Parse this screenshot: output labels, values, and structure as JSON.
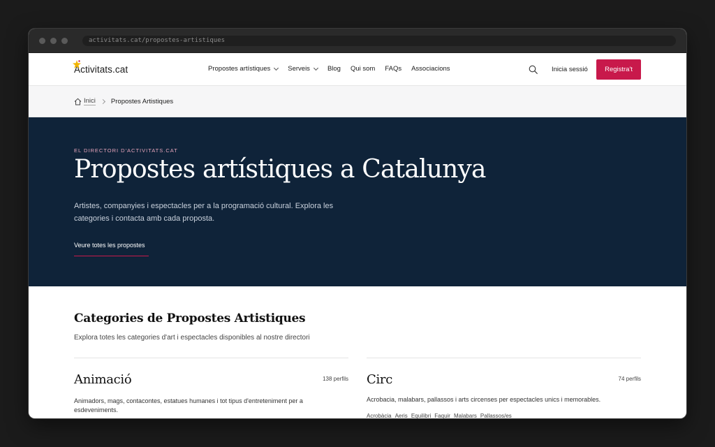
{
  "browser": {
    "url": "activitats.cat/propostes-artistiques"
  },
  "header": {
    "logo_text": "Activitats.cat",
    "nav": [
      {
        "label": "Propostes artístiques",
        "dropdown": true
      },
      {
        "label": "Serveis",
        "dropdown": true
      },
      {
        "label": "Blog",
        "dropdown": false
      },
      {
        "label": "Qui som",
        "dropdown": false
      },
      {
        "label": "FAQs",
        "dropdown": false
      },
      {
        "label": "Associacions",
        "dropdown": false
      }
    ],
    "login_label": "Inicia sessió",
    "register_label": "Registra't"
  },
  "breadcrumb": {
    "home": "Inici",
    "current": "Propostes Artistiques"
  },
  "hero": {
    "eyebrow": "EL DIRECTORI D'ACTIVITATS.CAT",
    "title": "Propostes artístiques a Catalunya",
    "description": "Artistes, companyies i espectacles per a la programació cultural. Explora les categories i contacta amb cada proposta.",
    "cta": "Veure totes les propostes"
  },
  "section": {
    "title": "Categories de Propostes Artistiques",
    "subtitle": "Explora totes les categories d'art i espectacles disponibles al nostre directori"
  },
  "categories": [
    {
      "name": "Animació",
      "count": "138 perfils",
      "description": "Animadors, mags, contacontes, estatues humanes i tot tipus d'entreteniment per a esdeveniments.",
      "tags": []
    },
    {
      "name": "Circ",
      "count": "74 perfils",
      "description": "Acrobacia, malabars, pallassos i arts circenses per espectacles unics i memorables.",
      "tags": [
        "Acrobàcia",
        "Aeris",
        "Equilibri",
        "Faquir",
        "Malabars",
        "Pallassos/es"
      ]
    }
  ],
  "colors": {
    "accent": "#c8194b",
    "hero_bg": "#0f2339",
    "eyebrow": "#e7a5bb"
  }
}
